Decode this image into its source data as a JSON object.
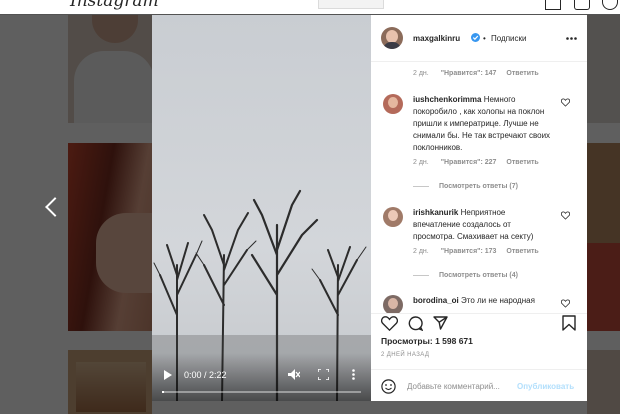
{
  "app": {
    "logo_text": "Instagram"
  },
  "post": {
    "author": "maxgalkinru",
    "verified": true,
    "separator": "•",
    "follow_label": "Подписки",
    "more_icon": "more-horizontal-icon",
    "views_label": "Просмотры: 1 598 671",
    "date_label": "2 ДНЕЙ НАЗАД",
    "add_comment_placeholder": "Добавьте комментарий...",
    "publish_label": "Опубликовать"
  },
  "video": {
    "time_label": "0:00 / 2:22",
    "progress_fraction": 0.0,
    "icons": [
      "play-icon",
      "mute-icon",
      "fullscreen-icon",
      "more-vertical-icon"
    ]
  },
  "comments": {
    "top_meta": {
      "age": "2 дн.",
      "likes": "\"Нравится\": 147",
      "reply": "Ответить"
    },
    "items": [
      {
        "user": "iushchenkorimma",
        "text": "Немного покоробило , как холопы на поклон пришли к императрице. Лучше не снимали бы. Не так встречают своих поклонников.",
        "age": "2 дн.",
        "likes": "\"Нравится\": 227",
        "reply": "Ответить",
        "view_replies": "Посмотреть ответы (7)"
      },
      {
        "user": "irishkanurik",
        "text": "Неприятное впечатление создалось от просмотра. Смахивает на секту)",
        "age": "2 дн.",
        "likes": "\"Нравится\": 173",
        "reply": "Ответить",
        "view_replies": "Посмотреть ответы (4)"
      },
      {
        "user": "borodina_oi",
        "text": "Это ли не народная",
        "age": "",
        "likes": "",
        "reply": "",
        "view_replies": ""
      }
    ]
  },
  "colors": {
    "accent": "#0095f6",
    "verified": "#3897f0",
    "overlay": "#000000"
  }
}
